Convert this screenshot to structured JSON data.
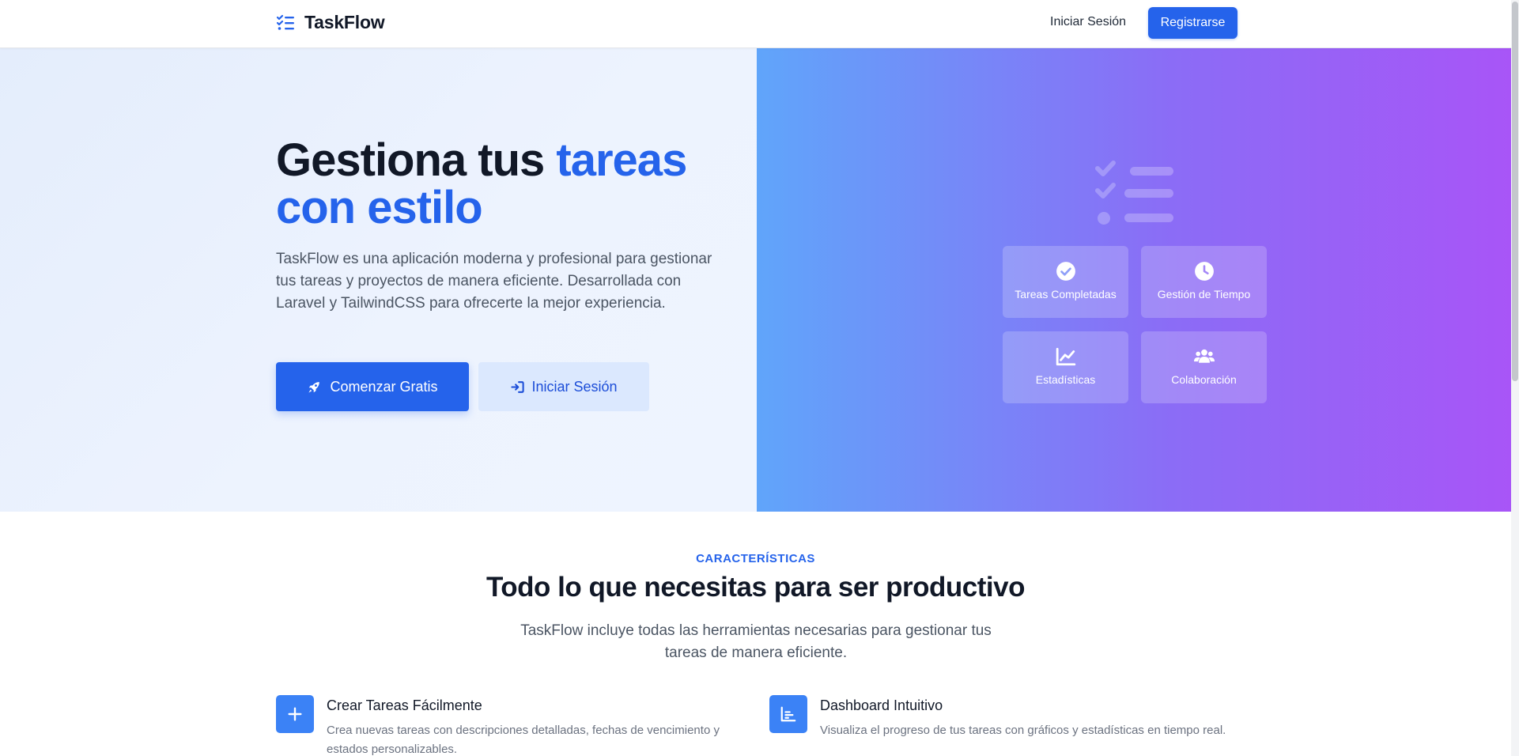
{
  "navbar": {
    "brand": "TaskFlow",
    "login": "Iniciar Sesión",
    "register": "Registrarse"
  },
  "hero": {
    "title_part1": "Gestiona tus ",
    "title_accent": "tareas con estilo",
    "description": "TaskFlow es una aplicación moderna y profesional para gestionar tus tareas y proyectos de manera eficiente. Desarrollada con Laravel y TailwindCSS para ofrecerte la mejor experiencia.",
    "primary_button": "Comenzar Gratis",
    "secondary_button": "Iniciar Sesión"
  },
  "showcase": {
    "cards": [
      {
        "label": "Tareas Completadas",
        "icon": "check-circle-icon"
      },
      {
        "label": "Gestión de Tiempo",
        "icon": "clock-icon"
      },
      {
        "label": "Estadísticas",
        "icon": "chart-line-icon"
      },
      {
        "label": "Colaboración",
        "icon": "users-icon"
      }
    ]
  },
  "features": {
    "eyebrow": "CARACTERÍSTICAS",
    "title": "Todo lo que necesitas para ser productivo",
    "description": "TaskFlow incluye todas las herramientas necesarias para gestionar tus tareas de manera eficiente.",
    "items": [
      {
        "title": "Crear Tareas Fácilmente",
        "text": "Crea nuevas tareas con descripciones detalladas, fechas de vencimiento y estados personalizables.",
        "icon": "plus-icon"
      },
      {
        "title": "Dashboard Intuitivo",
        "text": "Visualiza el progreso de tus tareas con gráficos y estadísticas en tiempo real.",
        "icon": "chart-bar-icon"
      }
    ]
  },
  "colors": {
    "primary": "#2563eb",
    "primary_light": "#dbe8fe",
    "hero_gradient_start": "#60a5fa",
    "hero_gradient_end": "#a855f7",
    "text_dark": "#111827",
    "text_muted": "#4b5563"
  }
}
